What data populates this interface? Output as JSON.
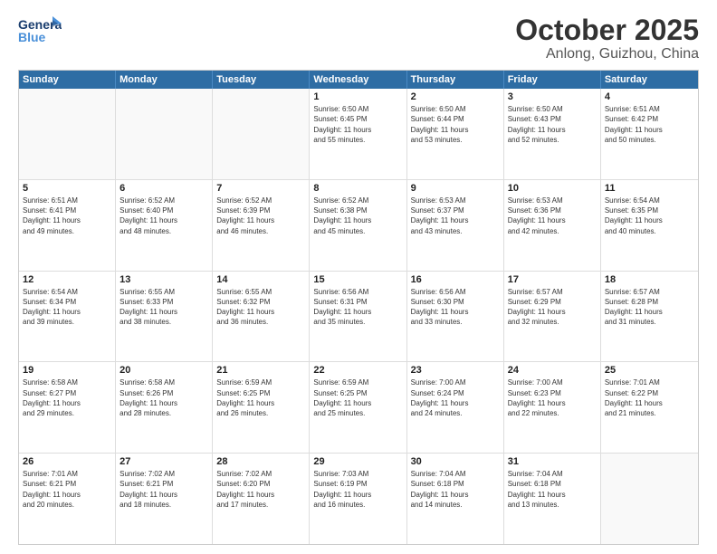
{
  "logo": {
    "line1": "General",
    "line2": "Blue"
  },
  "title": "October 2025",
  "subtitle": "Anlong, Guizhou, China",
  "days": [
    "Sunday",
    "Monday",
    "Tuesday",
    "Wednesday",
    "Thursday",
    "Friday",
    "Saturday"
  ],
  "weeks": [
    [
      {
        "day": "",
        "text": ""
      },
      {
        "day": "",
        "text": ""
      },
      {
        "day": "",
        "text": ""
      },
      {
        "day": "1",
        "text": "Sunrise: 6:50 AM\nSunset: 6:45 PM\nDaylight: 11 hours\nand 55 minutes."
      },
      {
        "day": "2",
        "text": "Sunrise: 6:50 AM\nSunset: 6:44 PM\nDaylight: 11 hours\nand 53 minutes."
      },
      {
        "day": "3",
        "text": "Sunrise: 6:50 AM\nSunset: 6:43 PM\nDaylight: 11 hours\nand 52 minutes."
      },
      {
        "day": "4",
        "text": "Sunrise: 6:51 AM\nSunset: 6:42 PM\nDaylight: 11 hours\nand 50 minutes."
      }
    ],
    [
      {
        "day": "5",
        "text": "Sunrise: 6:51 AM\nSunset: 6:41 PM\nDaylight: 11 hours\nand 49 minutes."
      },
      {
        "day": "6",
        "text": "Sunrise: 6:52 AM\nSunset: 6:40 PM\nDaylight: 11 hours\nand 48 minutes."
      },
      {
        "day": "7",
        "text": "Sunrise: 6:52 AM\nSunset: 6:39 PM\nDaylight: 11 hours\nand 46 minutes."
      },
      {
        "day": "8",
        "text": "Sunrise: 6:52 AM\nSunset: 6:38 PM\nDaylight: 11 hours\nand 45 minutes."
      },
      {
        "day": "9",
        "text": "Sunrise: 6:53 AM\nSunset: 6:37 PM\nDaylight: 11 hours\nand 43 minutes."
      },
      {
        "day": "10",
        "text": "Sunrise: 6:53 AM\nSunset: 6:36 PM\nDaylight: 11 hours\nand 42 minutes."
      },
      {
        "day": "11",
        "text": "Sunrise: 6:54 AM\nSunset: 6:35 PM\nDaylight: 11 hours\nand 40 minutes."
      }
    ],
    [
      {
        "day": "12",
        "text": "Sunrise: 6:54 AM\nSunset: 6:34 PM\nDaylight: 11 hours\nand 39 minutes."
      },
      {
        "day": "13",
        "text": "Sunrise: 6:55 AM\nSunset: 6:33 PM\nDaylight: 11 hours\nand 38 minutes."
      },
      {
        "day": "14",
        "text": "Sunrise: 6:55 AM\nSunset: 6:32 PM\nDaylight: 11 hours\nand 36 minutes."
      },
      {
        "day": "15",
        "text": "Sunrise: 6:56 AM\nSunset: 6:31 PM\nDaylight: 11 hours\nand 35 minutes."
      },
      {
        "day": "16",
        "text": "Sunrise: 6:56 AM\nSunset: 6:30 PM\nDaylight: 11 hours\nand 33 minutes."
      },
      {
        "day": "17",
        "text": "Sunrise: 6:57 AM\nSunset: 6:29 PM\nDaylight: 11 hours\nand 32 minutes."
      },
      {
        "day": "18",
        "text": "Sunrise: 6:57 AM\nSunset: 6:28 PM\nDaylight: 11 hours\nand 31 minutes."
      }
    ],
    [
      {
        "day": "19",
        "text": "Sunrise: 6:58 AM\nSunset: 6:27 PM\nDaylight: 11 hours\nand 29 minutes."
      },
      {
        "day": "20",
        "text": "Sunrise: 6:58 AM\nSunset: 6:26 PM\nDaylight: 11 hours\nand 28 minutes."
      },
      {
        "day": "21",
        "text": "Sunrise: 6:59 AM\nSunset: 6:25 PM\nDaylight: 11 hours\nand 26 minutes."
      },
      {
        "day": "22",
        "text": "Sunrise: 6:59 AM\nSunset: 6:25 PM\nDaylight: 11 hours\nand 25 minutes."
      },
      {
        "day": "23",
        "text": "Sunrise: 7:00 AM\nSunset: 6:24 PM\nDaylight: 11 hours\nand 24 minutes."
      },
      {
        "day": "24",
        "text": "Sunrise: 7:00 AM\nSunset: 6:23 PM\nDaylight: 11 hours\nand 22 minutes."
      },
      {
        "day": "25",
        "text": "Sunrise: 7:01 AM\nSunset: 6:22 PM\nDaylight: 11 hours\nand 21 minutes."
      }
    ],
    [
      {
        "day": "26",
        "text": "Sunrise: 7:01 AM\nSunset: 6:21 PM\nDaylight: 11 hours\nand 20 minutes."
      },
      {
        "day": "27",
        "text": "Sunrise: 7:02 AM\nSunset: 6:21 PM\nDaylight: 11 hours\nand 18 minutes."
      },
      {
        "day": "28",
        "text": "Sunrise: 7:02 AM\nSunset: 6:20 PM\nDaylight: 11 hours\nand 17 minutes."
      },
      {
        "day": "29",
        "text": "Sunrise: 7:03 AM\nSunset: 6:19 PM\nDaylight: 11 hours\nand 16 minutes."
      },
      {
        "day": "30",
        "text": "Sunrise: 7:04 AM\nSunset: 6:18 PM\nDaylight: 11 hours\nand 14 minutes."
      },
      {
        "day": "31",
        "text": "Sunrise: 7:04 AM\nSunset: 6:18 PM\nDaylight: 11 hours\nand 13 minutes."
      },
      {
        "day": "",
        "text": ""
      }
    ]
  ]
}
